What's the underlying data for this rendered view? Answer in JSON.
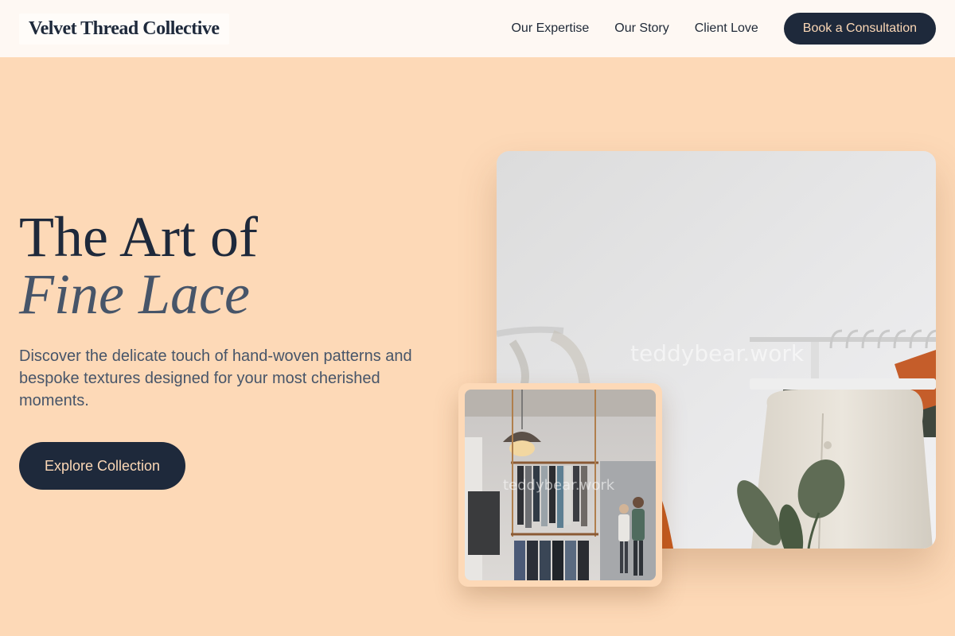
{
  "brand": {
    "name": "Velvet Thread Collective"
  },
  "nav": {
    "links": [
      "Our Expertise",
      "Our Story",
      "Client Love"
    ],
    "cta": "Book a Consultation"
  },
  "hero": {
    "title_line1": "The Art of",
    "title_line2": "Fine Lace",
    "description": "Discover the delicate touch of hand-woven patterns and bespoke textures designed for your most cherished moments.",
    "button": "Explore Collection"
  },
  "images": {
    "main_watermark": "teddybear.work",
    "inset_watermark": "teddybear.work"
  },
  "colors": {
    "page_bg": "#fdd9b7",
    "header_bg": "#fef8f3",
    "navy": "#1e293b",
    "slate": "#475569",
    "button_text": "#fcd8b6"
  }
}
